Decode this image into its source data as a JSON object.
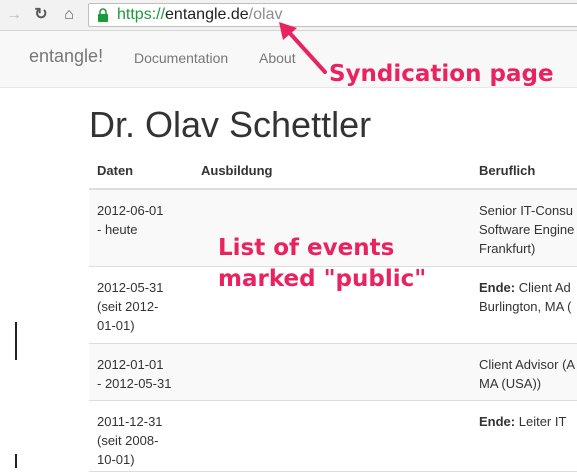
{
  "browser": {
    "url_scheme": "https://",
    "url_host": "entangle.de",
    "url_path": "/olav"
  },
  "nav": {
    "brand": "entangle!",
    "links": [
      "Documentation",
      "About"
    ]
  },
  "annotations": {
    "syndication": "Syndication page",
    "events_line1": "List of events",
    "events_line2": "marked \"public\"",
    "color": "#e8235f"
  },
  "page": {
    "title": "Dr. Olav Schettler"
  },
  "table": {
    "headers": [
      "Daten",
      "Ausbildung",
      "Beruflich"
    ],
    "rows": [
      {
        "date_lines": [
          "2012-06-01",
          "- heute"
        ],
        "education": "",
        "job_bold": "",
        "job_lines": [
          "Senior IT-Consu",
          "Software Engine",
          "Frankfurt)"
        ]
      },
      {
        "date_lines": [
          "2012-05-31",
          "(seit 2012-",
          "01-01)"
        ],
        "education": "",
        "job_bold": "Ende:",
        "job_lines": [
          " Client Ad",
          "Burlington, MA ("
        ]
      },
      {
        "date_lines": [
          "2012-01-01",
          "- 2012-05-31"
        ],
        "education": "",
        "job_bold": "",
        "job_lines": [
          "Client Advisor (A",
          "MA (USA))"
        ]
      },
      {
        "date_lines": [
          "2011-12-31",
          "(seit 2008-",
          "10-01)"
        ],
        "education": "",
        "job_bold": "Ende:",
        "job_lines": [
          " Leiter IT"
        ]
      }
    ]
  }
}
